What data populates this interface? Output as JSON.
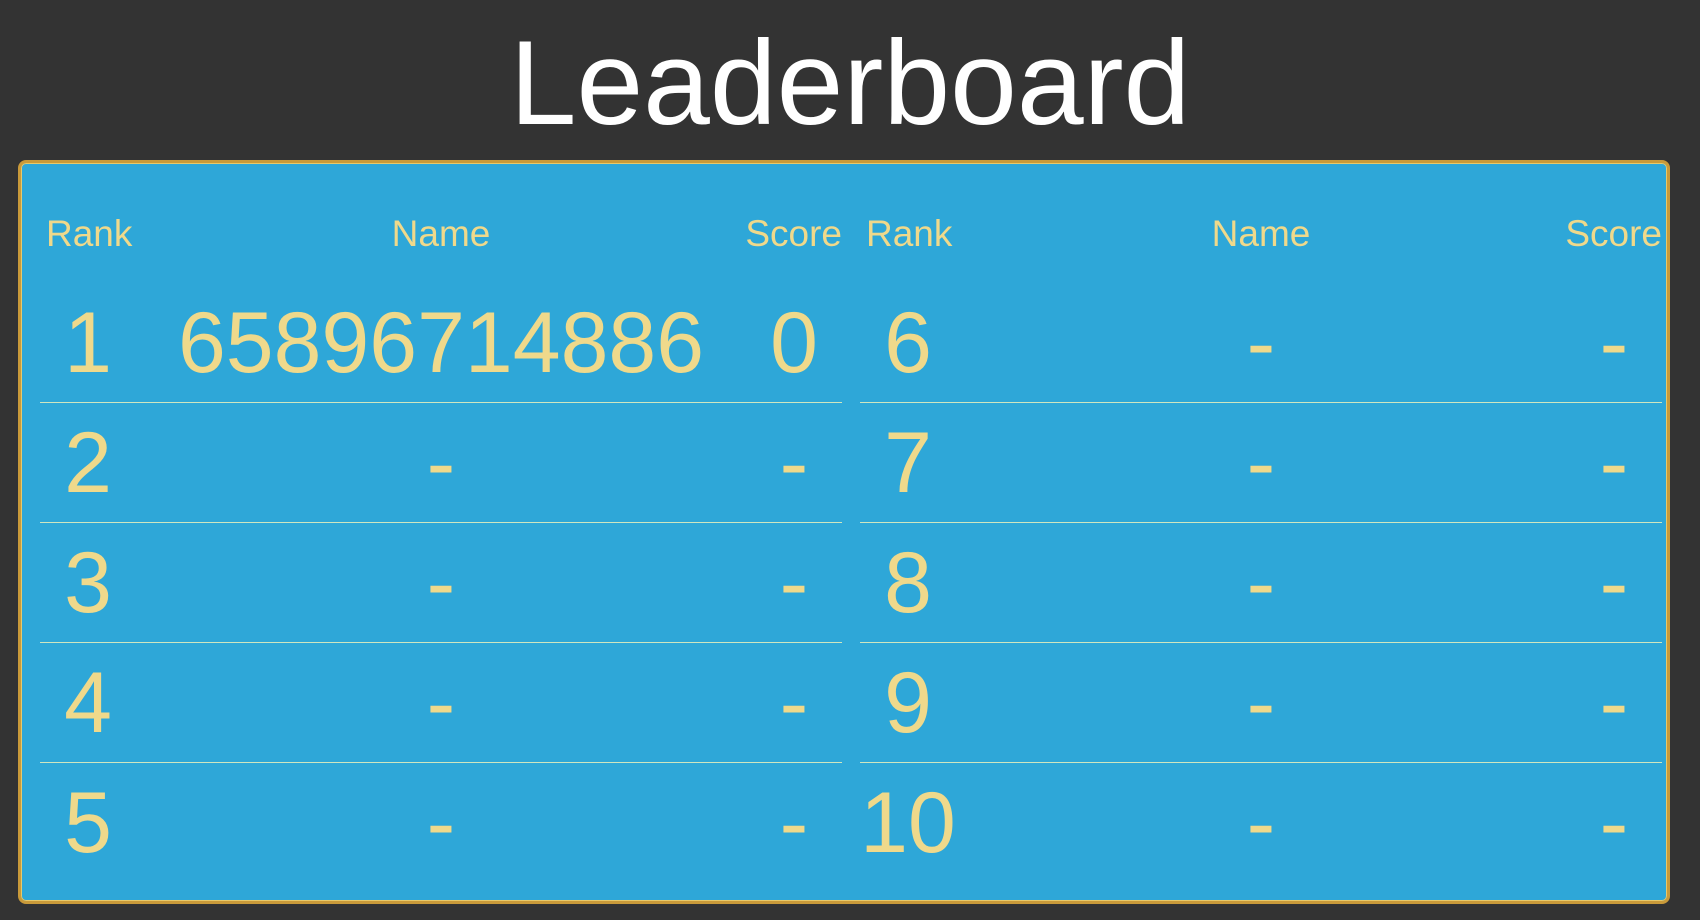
{
  "title": "Leaderboard",
  "headers": {
    "rank": "Rank",
    "name": "Name",
    "score": "Score"
  },
  "left": [
    {
      "rank": "1",
      "name": "65896714886",
      "score": "0"
    },
    {
      "rank": "2",
      "name": "-",
      "score": "-"
    },
    {
      "rank": "3",
      "name": "-",
      "score": "-"
    },
    {
      "rank": "4",
      "name": "-",
      "score": "-"
    },
    {
      "rank": "5",
      "name": "-",
      "score": "-"
    }
  ],
  "right": [
    {
      "rank": "6",
      "name": "-",
      "score": "-"
    },
    {
      "rank": "7",
      "name": "-",
      "score": "-"
    },
    {
      "rank": "8",
      "name": "-",
      "score": "-"
    },
    {
      "rank": "9",
      "name": "-",
      "score": "-"
    },
    {
      "rank": "10",
      "name": "-",
      "score": "-"
    }
  ],
  "colors": {
    "background": "#333333",
    "board": "#2ea7d8",
    "border": "#c99a3a",
    "text": "#efd98b"
  }
}
